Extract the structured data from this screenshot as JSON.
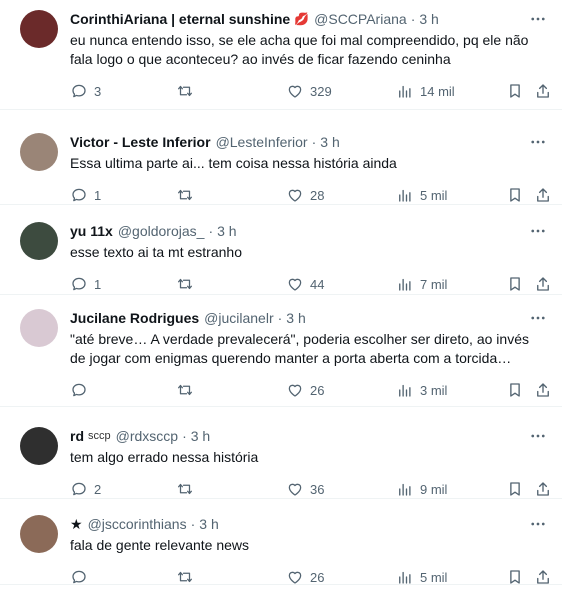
{
  "tweets": [
    {
      "name": "CorinthiAriana | eternal sunshine",
      "emoji": "💋",
      "handle": "@SCCPAriana",
      "time": "3 h",
      "text": "eu nunca entendo isso, se ele acha que foi mal compreendido, pq ele não fala logo o que aconteceu? ao invés de ficar fazendo ceninha",
      "replies": "3",
      "retweets": "",
      "likes": "329",
      "views": "14 mil",
      "avatar_color": "#6b2a2a"
    },
    {
      "name": "Victor - Leste Inferior",
      "emoji": "",
      "handle": "@LesteInferior",
      "time": "3 h",
      "text": "Essa ultima parte ai... tem coisa nessa história ainda",
      "replies": "1",
      "retweets": "",
      "likes": "28",
      "views": "5 mil",
      "avatar_color": "#9a8577"
    },
    {
      "name": "yu 11x",
      "emoji": "",
      "handle": "@goldorojas_",
      "time": "3 h",
      "text": "esse texto ai ta mt estranho",
      "replies": "1",
      "retweets": "",
      "likes": "44",
      "views": "7 mil",
      "avatar_color": "#3d4b3f"
    },
    {
      "name": "Jucilane Rodrigues",
      "emoji": "",
      "handle": "@jucilanelr",
      "time": "3 h",
      "text": "\"até breve… A verdade prevalecerá\", poderia escolher ser direto, ao invés de jogar com enigmas querendo manter a porta aberta com a torcida…",
      "replies": "",
      "retweets": "",
      "likes": "26",
      "views": "3 mil",
      "avatar_color": "#d9c9d3"
    },
    {
      "name": "rd",
      "badge": "sccp",
      "emoji": "",
      "handle": "@rdxsccp",
      "time": "3 h",
      "text": "tem algo errado nessa história",
      "replies": "2",
      "retweets": "",
      "likes": "36",
      "views": "9 mil",
      "avatar_color": "#2f2f2f"
    },
    {
      "name": "★",
      "emoji": "",
      "handle": "@jsccorinthians",
      "time": "3 h",
      "text": "fala de gente relevante news",
      "replies": "",
      "retweets": "",
      "likes": "26",
      "views": "5 mil",
      "avatar_color": "#8b6a58"
    }
  ],
  "icons": {
    "reply": "reply-icon",
    "retweet": "retweet-icon",
    "like": "heart-icon",
    "views": "analytics-icon",
    "bookmark": "bookmark-icon",
    "share": "share-icon",
    "more": "more-icon"
  },
  "colors": {
    "text": "#0f1419",
    "muted": "#536471",
    "divider": "#eff3f4",
    "lips": "#c8102e"
  }
}
